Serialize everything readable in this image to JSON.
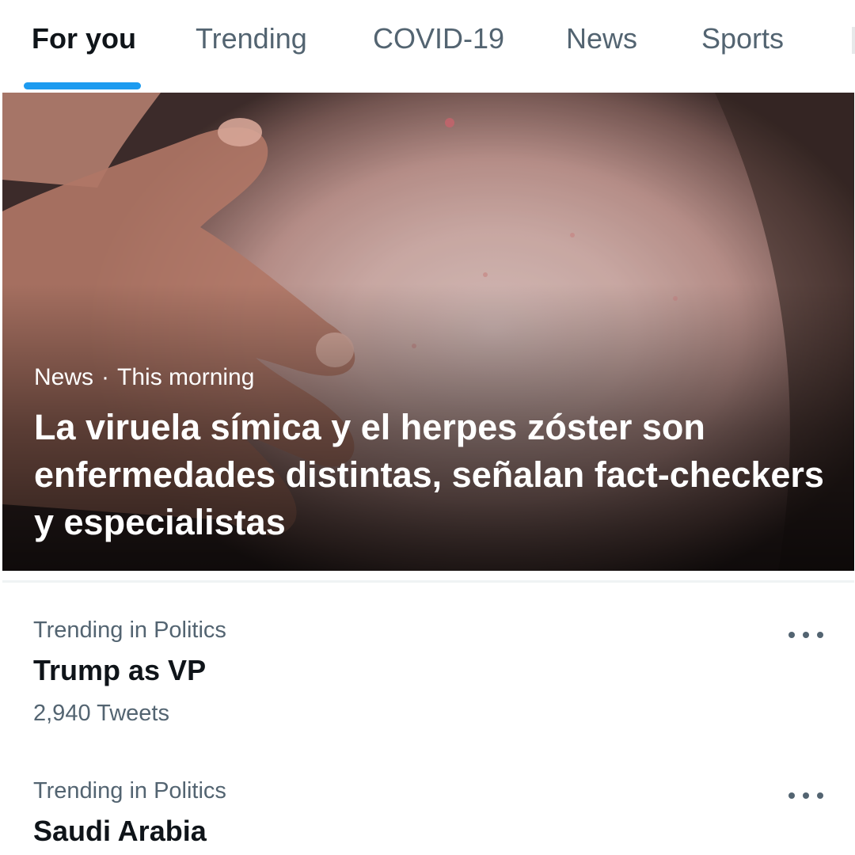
{
  "tabs": [
    {
      "label": "For you",
      "active": true
    },
    {
      "label": "Trending",
      "active": false
    },
    {
      "label": "COVID-19",
      "active": false
    },
    {
      "label": "News",
      "active": false
    },
    {
      "label": "Sports",
      "active": false
    }
  ],
  "hero": {
    "category": "News",
    "separator": "·",
    "time": "This morning",
    "headline": "La viruela símica y el herpes zóster son enfermedades distintas, señalan fact-checkers y especialistas"
  },
  "trends": [
    {
      "context": "Trending in Politics",
      "title": "Trump as VP",
      "count": "2,940 Tweets"
    },
    {
      "context": "Trending in Politics",
      "title": "Saudi Arabia",
      "count": ""
    }
  ],
  "colors": {
    "accent": "#1d9bf0",
    "primary_text": "#0f1419",
    "secondary_text": "#536471"
  },
  "icons": {
    "more": "more-horizontal-icon"
  }
}
